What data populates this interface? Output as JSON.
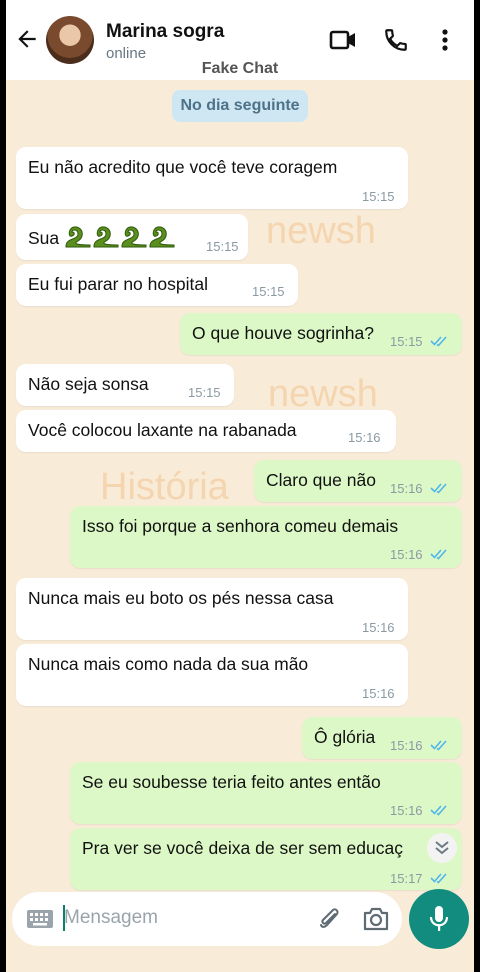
{
  "header": {
    "contact_name": "Marina sogra",
    "status": "online",
    "caption": "Fake Chat"
  },
  "watermark": [
    "newsh",
    "newsh",
    "História"
  ],
  "date_chip": "No dia seguinte",
  "messages": [
    {
      "side": "in",
      "text": "Eu não acredito que você teve coragem",
      "time": "15:15"
    },
    {
      "side": "in",
      "text": "Sua",
      "emoji": "snake-icon x4",
      "time": "15:15"
    },
    {
      "side": "in",
      "text": "Eu fui parar no hospital",
      "time": "15:15"
    },
    {
      "side": "out",
      "text": "O que houve sogrinha?",
      "time": "15:15",
      "read": true
    },
    {
      "side": "in",
      "text": "Não seja sonsa",
      "time": "15:15"
    },
    {
      "side": "in",
      "text": "Você colocou laxante na rabanada",
      "time": "15:16"
    },
    {
      "side": "out",
      "text": "Claro que não",
      "time": "15:16",
      "read": true
    },
    {
      "side": "out",
      "text": "Isso foi porque a senhora comeu demais",
      "time": "15:16",
      "read": true
    },
    {
      "side": "in",
      "text": "Nunca mais eu boto os pés nessa casa",
      "time": "15:16"
    },
    {
      "side": "in",
      "text": "Nunca mais como nada da sua mão",
      "time": "15:16"
    },
    {
      "side": "out",
      "text": "Ô glória",
      "time": "15:16",
      "read": true
    },
    {
      "side": "out",
      "text": "Se eu soubesse teria feito antes então",
      "time": "15:16",
      "read": true
    },
    {
      "side": "out",
      "text": "Pra ver se você deixa de ser sem educaç",
      "time": "15:17",
      "read": true
    }
  ],
  "composer": {
    "placeholder": "Mensagem"
  },
  "colors": {
    "incoming": "#ffffff",
    "outgoing": "#dcf8c6",
    "accent": "#128c7e",
    "tick_read": "#4fb6ec",
    "background": "#f8ebd8"
  }
}
